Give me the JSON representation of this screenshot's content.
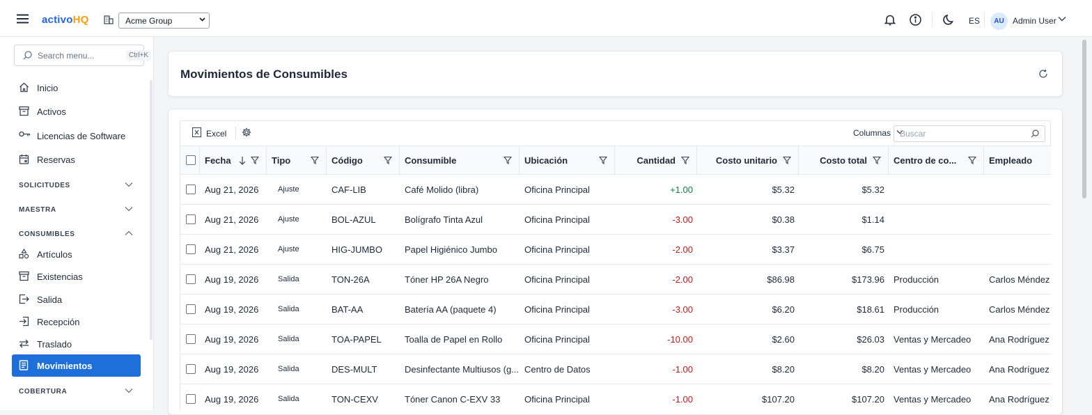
{
  "topbar": {
    "logo_part1": "activo",
    "logo_part2": "HQ",
    "org_selected": "Acme Group",
    "lang": "ES",
    "avatar_initials": "AU",
    "user_name": "Admin User"
  },
  "sidebar": {
    "search_placeholder": "Search menu...",
    "search_shortcut": "Ctrl+K",
    "items": {
      "inicio": "Inicio",
      "activos": "Activos",
      "licencias": "Licencias de Software",
      "reservas": "Reservas"
    },
    "sections": {
      "solicitudes": "SOLICITUDES",
      "maestra": "MAESTRA",
      "consumibles": "CONSUMIBLES",
      "cobertura": "COBERTURA"
    },
    "consumibles_items": {
      "articulos": "Artículos",
      "existencias": "Existencias",
      "salida": "Salida",
      "recepcion": "Recepción",
      "traslado": "Traslado",
      "movimientos": "Movimientos"
    }
  },
  "page": {
    "title": "Movimientos de Consumibles"
  },
  "toolbar": {
    "excel_label": "Excel",
    "columns_label": "Columnas",
    "search_placeholder": "Buscar"
  },
  "table": {
    "headers": {
      "fecha": "Fecha",
      "tipo": "Tipo",
      "codigo": "Código",
      "consumible": "Consumible",
      "ubicacion": "Ubicación",
      "cantidad": "Cantidad",
      "costo_unitario": "Costo unitario",
      "costo_total": "Costo total",
      "centro": "Centro de co...",
      "empleado": "Empleado"
    },
    "rows": [
      {
        "fecha": "Aug 21, 2026",
        "tipo": "Ajuste",
        "codigo": "CAF-LIB",
        "consumible": "Café Molido (libra)",
        "ubicacion": "Oficina Principal",
        "cantidad": "+1.00",
        "costo_unitario": "$5.32",
        "costo_total": "$5.32",
        "centro": "",
        "empleado": ""
      },
      {
        "fecha": "Aug 21, 2026",
        "tipo": "Ajuste",
        "codigo": "BOL-AZUL",
        "consumible": "Bolígrafo Tinta Azul",
        "ubicacion": "Oficina Principal",
        "cantidad": "-3.00",
        "costo_unitario": "$0.38",
        "costo_total": "$1.14",
        "centro": "",
        "empleado": ""
      },
      {
        "fecha": "Aug 21, 2026",
        "tipo": "Ajuste",
        "codigo": "HIG-JUMBO",
        "consumible": "Papel Higiénico Jumbo",
        "ubicacion": "Oficina Principal",
        "cantidad": "-2.00",
        "costo_unitario": "$3.37",
        "costo_total": "$6.75",
        "centro": "",
        "empleado": ""
      },
      {
        "fecha": "Aug 19, 2026",
        "tipo": "Salida",
        "codigo": "TON-26A",
        "consumible": "Tóner HP 26A Negro",
        "ubicacion": "Oficina Principal",
        "cantidad": "-2.00",
        "costo_unitario": "$86.98",
        "costo_total": "$173.96",
        "centro": "Producción",
        "empleado": "Carlos Méndez"
      },
      {
        "fecha": "Aug 19, 2026",
        "tipo": "Salida",
        "codigo": "BAT-AA",
        "consumible": "Batería AA (paquete 4)",
        "ubicacion": "Oficina Principal",
        "cantidad": "-3.00",
        "costo_unitario": "$6.20",
        "costo_total": "$18.61",
        "centro": "Producción",
        "empleado": "Carlos Méndez"
      },
      {
        "fecha": "Aug 19, 2026",
        "tipo": "Salida",
        "codigo": "TOA-PAPEL",
        "consumible": "Toalla de Papel en Rollo",
        "ubicacion": "Oficina Principal",
        "cantidad": "-10.00",
        "costo_unitario": "$2.60",
        "costo_total": "$26.03",
        "centro": "Ventas y Mercadeo",
        "empleado": "Ana Rodríguez"
      },
      {
        "fecha": "Aug 19, 2026",
        "tipo": "Salida",
        "codigo": "DES-MULT",
        "consumible": "Desinfectante Multiusos (g...",
        "ubicacion": "Centro de Datos",
        "cantidad": "-1.00",
        "costo_unitario": "$8.20",
        "costo_total": "$8.20",
        "centro": "Ventas y Mercadeo",
        "empleado": "Ana Rodríguez"
      },
      {
        "fecha": "Aug 19, 2026",
        "tipo": "Salida",
        "codigo": "TON-CEXV",
        "consumible": "Tóner Canon C-EXV 33",
        "ubicacion": "Oficina Principal",
        "cantidad": "-1.00",
        "costo_unitario": "$107.20",
        "costo_total": "$107.20",
        "centro": "Ventas y Mercadeo",
        "empleado": "Ana Rodríguez"
      }
    ]
  },
  "colors": {
    "accent": "#1e6fd9",
    "positive": "#15803d",
    "negative": "#b91c1c",
    "logo_blue": "#2563eb",
    "logo_orange": "#f59e0b"
  }
}
